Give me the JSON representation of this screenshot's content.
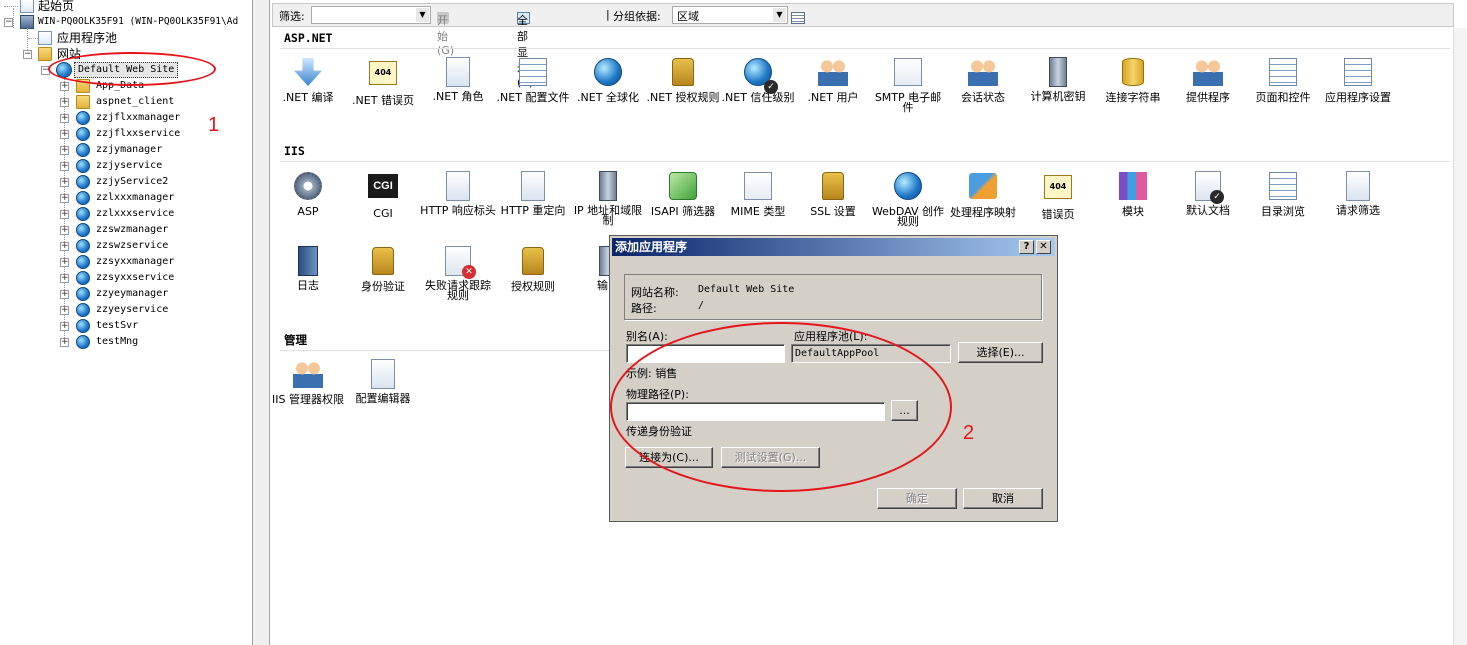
{
  "tree": {
    "start_page": "起始页",
    "server": "WIN-PQ0OLK35F91 (WIN-PQ0OLK35F91\\Ad",
    "app_pools": "应用程序池",
    "sites": "网站",
    "default_site": "Default Web Site",
    "children": [
      "App_Data",
      "aspnet_client",
      "zzjflxxmanager",
      "zzjflxxservice",
      "zzjymanager",
      "zzjyservice",
      "zzjyService2",
      "zzlxxxmanager",
      "zzlxxxservice",
      "zzswzmanager",
      "zzswzservice",
      "zzsyxxmanager",
      "zzsyxxservice",
      "zzyeymanager",
      "zzyeyservice",
      "testSvr",
      "testMng"
    ]
  },
  "filterbar": {
    "filter_label": "筛选:",
    "start_label": "开始(G)",
    "show_all_label": "全部显示(A)",
    "group_label": "分组依据:",
    "group_value": "区域"
  },
  "sections": {
    "aspnet": {
      "title": "ASP.NET",
      "features": [
        ".NET 编译",
        ".NET 错误页",
        ".NET 角色",
        ".NET 配置文件",
        ".NET 全球化",
        ".NET 授权规则",
        ".NET 信任级别",
        ".NET 用户",
        "SMTP 电子邮件",
        "会话状态",
        "计算机密钥",
        "连接字符串",
        "提供程序",
        "页面和控件",
        "应用程序设置"
      ]
    },
    "iis": {
      "title": "IIS",
      "features": [
        "ASP",
        "CGI",
        "HTTP 响应标头",
        "HTTP 重定向",
        "IP 地址和域限制",
        "ISAPI 筛选器",
        "MIME 类型",
        "SSL 设置",
        "WebDAV 创作规则",
        "处理程序映射",
        "错误页",
        "模块",
        "默认文档",
        "目录浏览",
        "请求筛选"
      ],
      "features_row2": [
        "日志",
        "身份验证",
        "失败请求跟踪规则",
        "授权规则",
        "输出"
      ]
    },
    "manage": {
      "title": "管理",
      "features": [
        "IIS 管理器权限",
        "配置编辑器"
      ]
    }
  },
  "dialog": {
    "title": "添加应用程序",
    "help_button": "?",
    "close_button": "✕",
    "site_name_label": "网站名称:",
    "site_name_value": "Default Web Site",
    "path_label": "路径:",
    "path_value": "/",
    "alias_label": "别名(A):",
    "alias_value": "",
    "app_pool_label": "应用程序池(L):",
    "app_pool_value": "DefaultAppPool",
    "select_button": "选择(E)...",
    "example_text": "示例: 销售",
    "physical_path_label": "物理路径(P):",
    "physical_path_value": "",
    "browse_button": "...",
    "pass_through_label": "传递身份验证",
    "connect_as_button": "连接为(C)...",
    "test_settings_button": "测试设置(G)...",
    "ok_button": "确定",
    "cancel_button": "取消"
  },
  "annotations": {
    "marker_1": "1",
    "marker_2": "2",
    "color": "#e4161b"
  }
}
